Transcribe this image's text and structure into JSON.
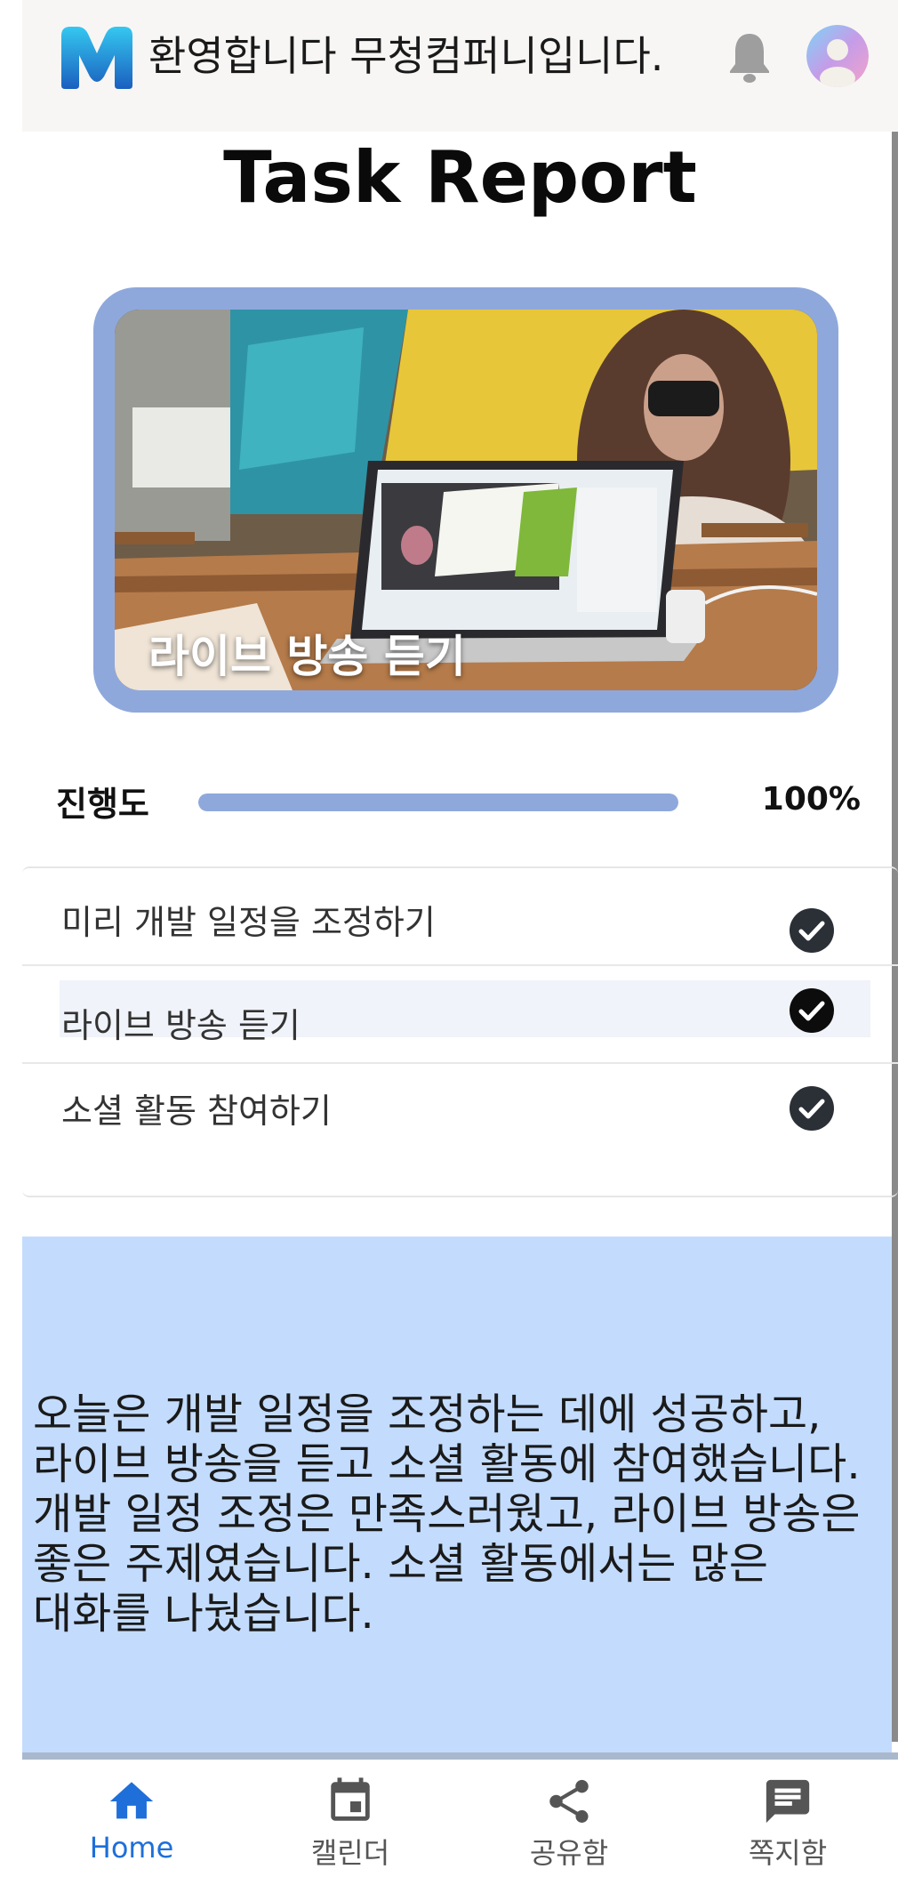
{
  "header": {
    "welcome_text": "환영합니다 무청컴퍼니입니다."
  },
  "page": {
    "title": "Task Report"
  },
  "card": {
    "caption": "라이브 방송 듣기"
  },
  "progress": {
    "label": "진행도",
    "value_text": "100%",
    "fraction": 1.0
  },
  "tasks": [
    {
      "label": "미리 개발 일정을 조정하기",
      "done": true
    },
    {
      "label": "라이브 방송 듣기",
      "done": true
    },
    {
      "label": "소셜 활동 참여하기",
      "done": true
    }
  ],
  "summary": {
    "text": "오늘은 개발 일정을 조정하는 데에 성공하고, 라이브 방송을 듣고 소셜 활동에 참여했습니다. 개발 일정 조정은 만족스러웠고, 라이브 방송은 좋은 주제였습니다. 소셜 활동에서는 많은 대화를 나눴습니다."
  },
  "nav": {
    "items": [
      {
        "label": "Home",
        "icon": "home-icon",
        "active": true
      },
      {
        "label": "캘린더",
        "icon": "calendar-icon",
        "active": false
      },
      {
        "label": "공유함",
        "icon": "share-icon",
        "active": false
      },
      {
        "label": "쪽지함",
        "icon": "message-icon",
        "active": false
      }
    ]
  },
  "colors": {
    "accent": "#8fa8dc",
    "nav_active": "#1e6fd9",
    "summary_bg": "#c3dcfd",
    "header_bg": "#f8f6f4"
  }
}
